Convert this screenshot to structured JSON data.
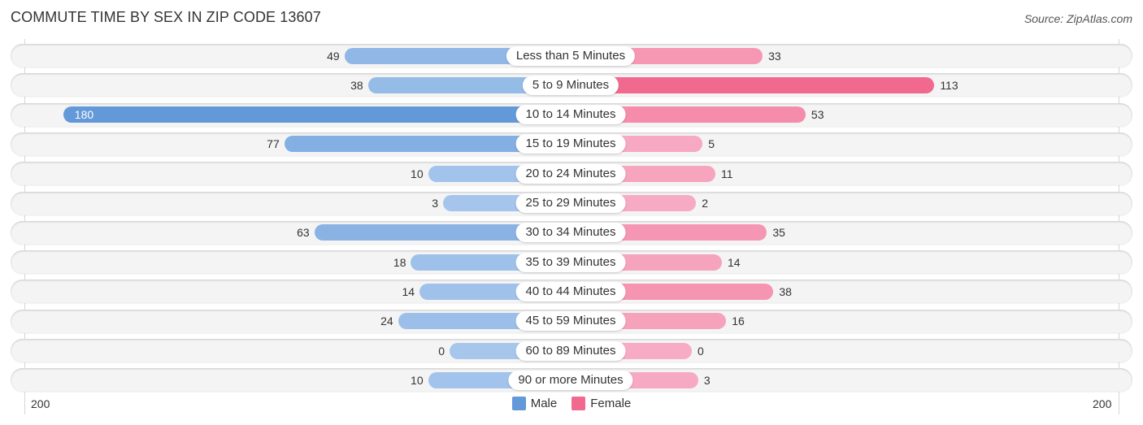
{
  "chart_data": {
    "type": "bar",
    "orientation": "horizontal-diverging",
    "title": "COMMUTE TIME BY SEX IN ZIP CODE 13607",
    "source": "Source: ZipAtlas.com",
    "categories": [
      "Less than 5 Minutes",
      "5 to 9 Minutes",
      "10 to 14 Minutes",
      "15 to 19 Minutes",
      "20 to 24 Minutes",
      "25 to 29 Minutes",
      "30 to 34 Minutes",
      "35 to 39 Minutes",
      "40 to 44 Minutes",
      "45 to 59 Minutes",
      "60 to 89 Minutes",
      "90 or more Minutes"
    ],
    "series": [
      {
        "name": "Male",
        "color": "#6399d8",
        "light_color": "#a6c6ec",
        "values": [
          49,
          38,
          180,
          77,
          10,
          3,
          63,
          18,
          14,
          24,
          0,
          10
        ]
      },
      {
        "name": "Female",
        "color": "#f2698f",
        "light_color": "#f7abc4",
        "values": [
          33,
          113,
          53,
          5,
          11,
          2,
          35,
          14,
          38,
          16,
          0,
          3
        ]
      }
    ],
    "axis": {
      "left_label": "200",
      "right_label": "200",
      "range": [
        0,
        200
      ]
    },
    "legend": {
      "position": "bottom-center",
      "items": [
        "Male",
        "Female"
      ]
    }
  }
}
